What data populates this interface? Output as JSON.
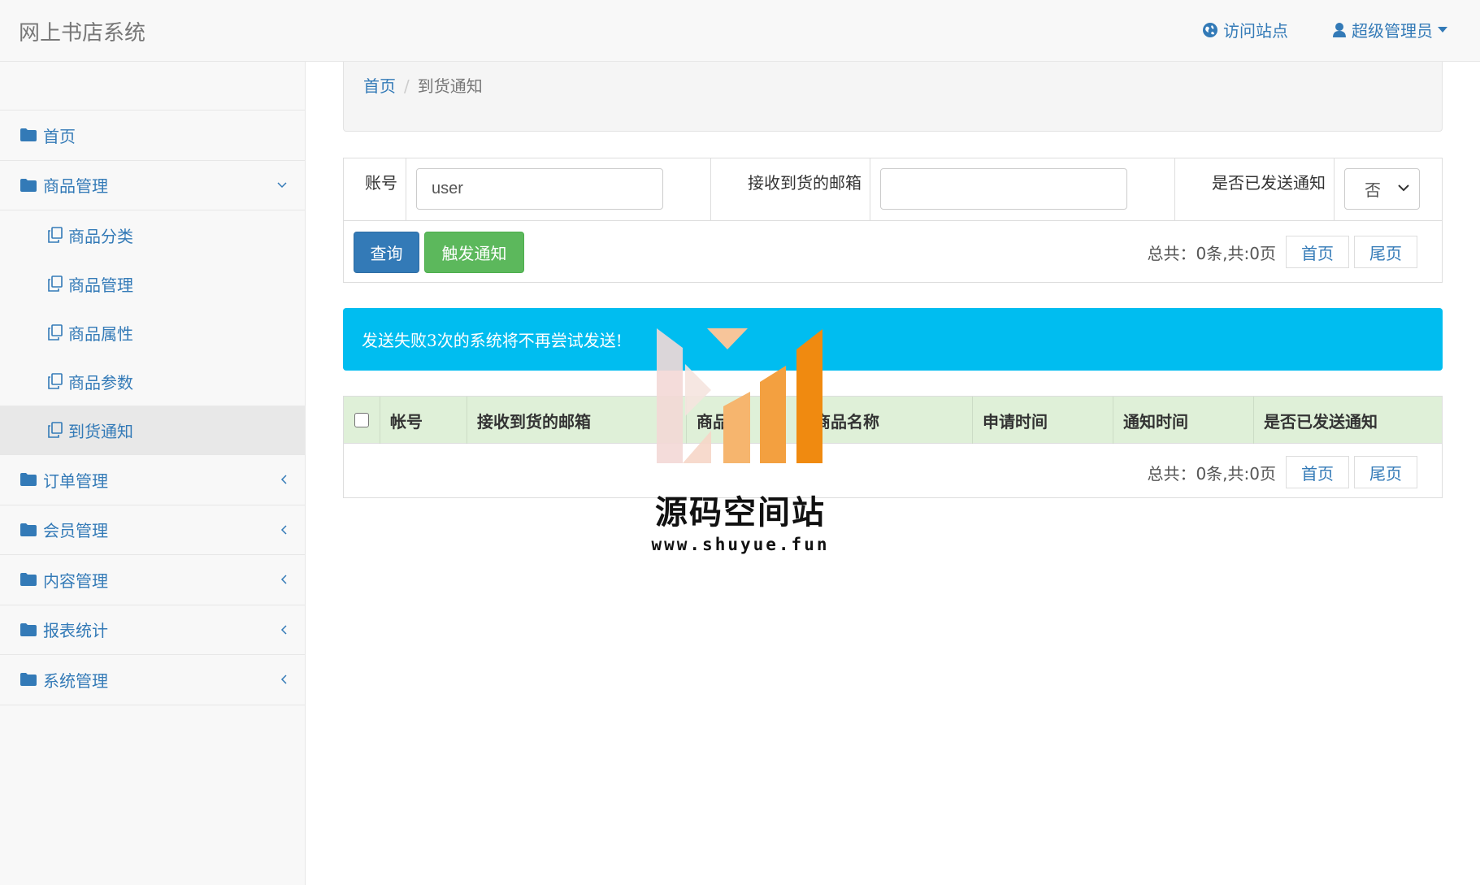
{
  "app": {
    "title": "网上书店系统"
  },
  "topnav": {
    "visit_site": "访问站点",
    "user": "超级管理员"
  },
  "sidebar": {
    "items": [
      {
        "label": "首页"
      },
      {
        "label": "商品管理",
        "expanded": true,
        "children": [
          {
            "label": "商品分类"
          },
          {
            "label": "商品管理"
          },
          {
            "label": "商品属性"
          },
          {
            "label": "商品参数"
          },
          {
            "label": "到货通知",
            "active": true
          }
        ]
      },
      {
        "label": "订单管理"
      },
      {
        "label": "会员管理"
      },
      {
        "label": "内容管理"
      },
      {
        "label": "报表统计"
      },
      {
        "label": "系统管理"
      }
    ]
  },
  "breadcrumb": {
    "home": "首页",
    "current": "到货通知"
  },
  "filter": {
    "account_label": "账号",
    "account_value": "user",
    "email_label": "接收到货的邮箱",
    "email_value": "",
    "sent_label": "是否已发送通知",
    "sent_value": "否",
    "query_button": "查询",
    "trigger_button": "触发通知"
  },
  "pager": {
    "info": "总共：0条,共:0页",
    "first": "首页",
    "last": "尾页"
  },
  "alert": {
    "text": "发送失败3次的系统将不再尝试发送!"
  },
  "table": {
    "columns": [
      "帐号",
      "接收到货的邮箱",
      "商品",
      "商品名称",
      "申请时间",
      "通知时间",
      "是否已发送通知"
    ],
    "rows": []
  },
  "watermark": {
    "title": "源码空间站",
    "url": "www.shuyue.fun"
  },
  "colors": {
    "primary": "#337ab7",
    "success": "#5cb85c",
    "alert": "#00bdf0",
    "table_head": "#dff0d8"
  }
}
